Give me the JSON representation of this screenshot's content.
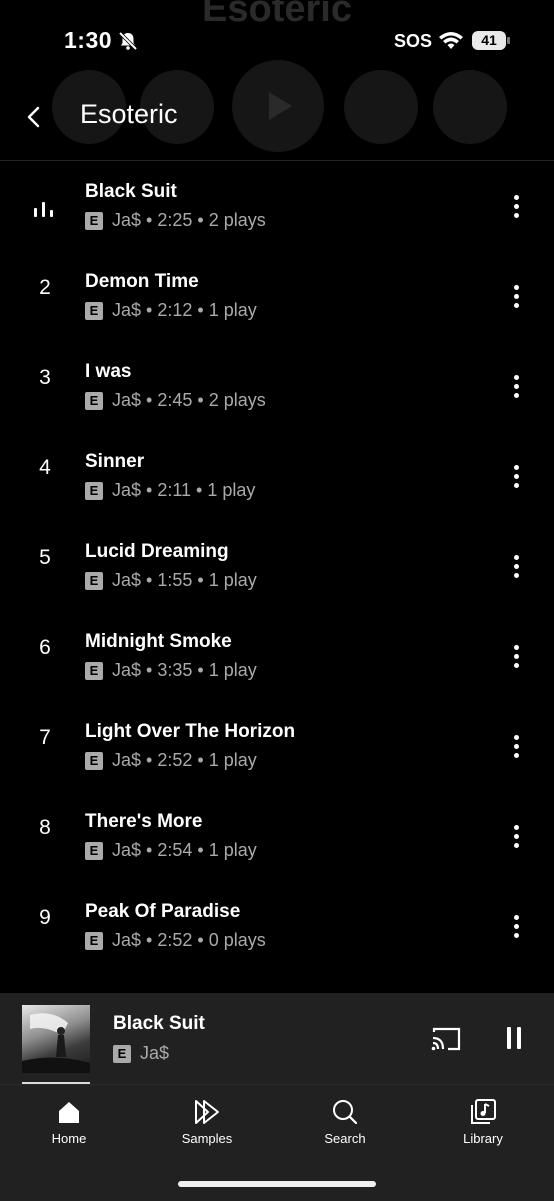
{
  "status_bar": {
    "time": "1:30",
    "carrier": "SOS",
    "battery": "41"
  },
  "header": {
    "title": "Esoteric",
    "background_title": "Esoteric"
  },
  "tracks": [
    {
      "number": "",
      "title": "Black Suit",
      "explicit": "E",
      "artist": "Ja$",
      "duration": "2:25",
      "plays": "2 plays",
      "now_playing": true
    },
    {
      "number": "2",
      "title": "Demon Time",
      "explicit": "E",
      "artist": "Ja$",
      "duration": "2:12",
      "plays": "1 play",
      "now_playing": false
    },
    {
      "number": "3",
      "title": "I was",
      "explicit": "E",
      "artist": "Ja$",
      "duration": "2:45",
      "plays": "2 plays",
      "now_playing": false
    },
    {
      "number": "4",
      "title": "Sinner",
      "explicit": "E",
      "artist": "Ja$",
      "duration": "2:11",
      "plays": "1 play",
      "now_playing": false
    },
    {
      "number": "5",
      "title": "Lucid Dreaming",
      "explicit": "E",
      "artist": "Ja$",
      "duration": "1:55",
      "plays": "1 play",
      "now_playing": false
    },
    {
      "number": "6",
      "title": "Midnight Smoke",
      "explicit": "E",
      "artist": "Ja$",
      "duration": "3:35",
      "plays": "1 play",
      "now_playing": false
    },
    {
      "number": "7",
      "title": "Light Over The Horizon",
      "explicit": "E",
      "artist": "Ja$",
      "duration": "2:52",
      "plays": "1 play",
      "now_playing": false
    },
    {
      "number": "8",
      "title": "There's More",
      "explicit": "E",
      "artist": "Ja$",
      "duration": "2:54",
      "plays": "1 play",
      "now_playing": false
    },
    {
      "number": "9",
      "title": "Peak Of Paradise",
      "explicit": "E",
      "artist": "Ja$",
      "duration": "2:52",
      "plays": "0 plays",
      "now_playing": false
    }
  ],
  "separator": " • ",
  "mini_player": {
    "title": "Black Suit",
    "explicit": "E",
    "artist": "Ja$",
    "state": "playing"
  },
  "nav": [
    {
      "label": "Home",
      "icon": "home-icon",
      "active": true
    },
    {
      "label": "Samples",
      "icon": "samples-icon",
      "active": false
    },
    {
      "label": "Search",
      "icon": "search-icon",
      "active": false
    },
    {
      "label": "Library",
      "icon": "library-icon",
      "active": false
    }
  ],
  "colors": {
    "background": "#000000",
    "secondary_text": "#aaaaaa",
    "bar_background": "#212121"
  }
}
